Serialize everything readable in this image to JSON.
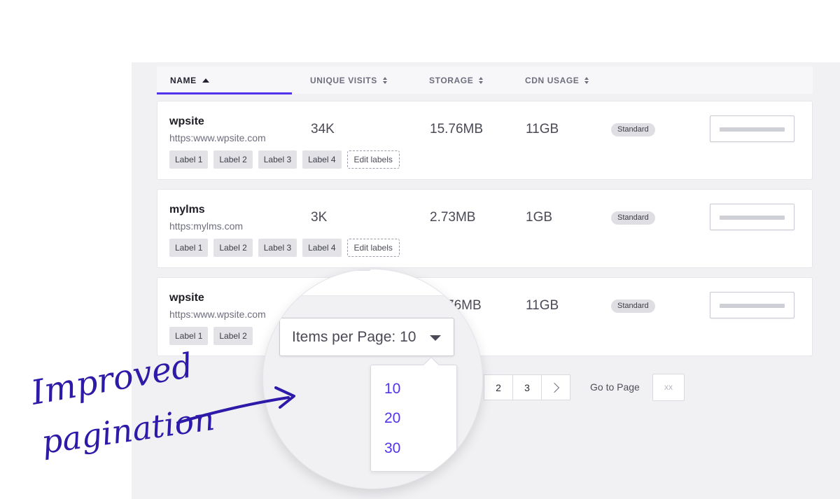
{
  "columns": {
    "name": "NAME",
    "unique_visits": "UNIQUE VISITS",
    "storage": "STORAGE",
    "cdn_usage": "CDN USAGE"
  },
  "sites": [
    {
      "name": "wpsite",
      "url": "https:www.wpsite.com",
      "labels": [
        "Label 1",
        "Label 2",
        "Label 3",
        "Label 4"
      ],
      "edit_label": "Edit labels",
      "unique_visits": "34K",
      "storage": "15.76MB",
      "cdn_usage": "11GB",
      "plan": "Standard"
    },
    {
      "name": "mylms",
      "url": "https:mylms.com",
      "labels": [
        "Label 1",
        "Label 2",
        "Label 3",
        "Label 4"
      ],
      "edit_label": "Edit labels",
      "unique_visits": "3K",
      "storage": "2.73MB",
      "cdn_usage": "1GB",
      "plan": "Standard"
    },
    {
      "name": "wpsite",
      "url": "https:www.wpsite.com",
      "labels": [
        "Label 1",
        "Label 2"
      ],
      "storage_partial": "76MB",
      "cdn_usage": "11GB",
      "plan": "Standard"
    }
  ],
  "pagination": {
    "pages": [
      "2",
      "3"
    ],
    "goto_label": "Go to Page",
    "goto_placeholder": "xx",
    "items_per_page_label": "Items per Page: 10",
    "options": [
      "10",
      "20",
      "30"
    ]
  },
  "annotation": {
    "line1": "Improved",
    "line2": "pagination",
    "color": "#2e1aa8"
  },
  "colors": {
    "accent": "#5333ed",
    "panel": "#f1f1f4"
  }
}
